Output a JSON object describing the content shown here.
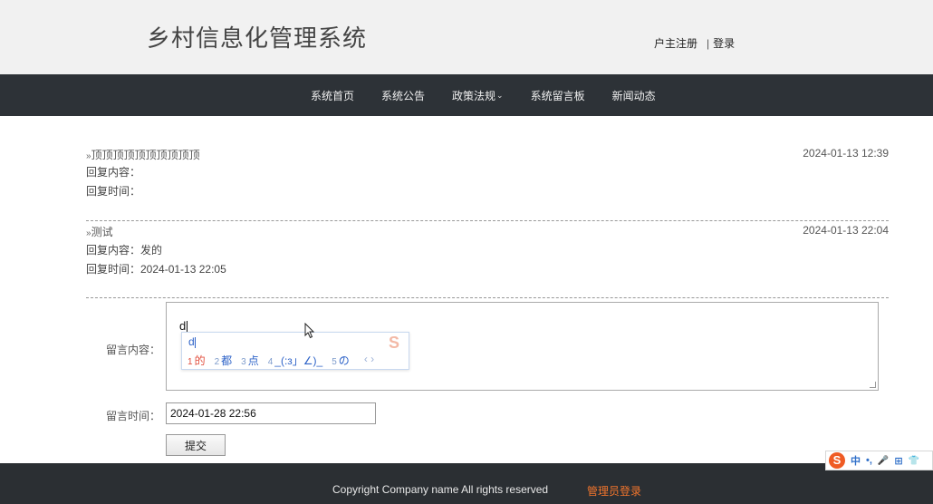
{
  "header": {
    "site_title": "乡村信息化管理系统",
    "register_link": "户主注册",
    "separator": "|",
    "login_link": "登录"
  },
  "nav": {
    "items": [
      {
        "label": "系统首页"
      },
      {
        "label": "系统公告"
      },
      {
        "label": "政策法规",
        "caret": "⌄"
      },
      {
        "label": "系统留言板"
      },
      {
        "label": "新闻动态"
      }
    ]
  },
  "messages": [
    {
      "prefix": "»",
      "title": "顶顶顶顶顶顶顶顶顶顶",
      "time": "2024-01-13 12:39",
      "reply_content": "回复内容：",
      "reply_time": "回复时间："
    },
    {
      "prefix": "»",
      "title": "测试",
      "time": "2024-01-13 22:04",
      "reply_content": "回复内容：发的",
      "reply_time": "回复时间：2024-01-13 22:05"
    }
  ],
  "form": {
    "content_label": "留言内容：",
    "content_value": "d",
    "time_label": "留言时间：",
    "time_value": "2024-01-28 22:56",
    "submit_label": "提交"
  },
  "ime": {
    "input": "d",
    "candidates": [
      {
        "num": "1",
        "text": "的"
      },
      {
        "num": "2",
        "text": "都"
      },
      {
        "num": "3",
        "text": "点"
      },
      {
        "num": "4",
        "text": "_(:з」∠)_"
      },
      {
        "num": "5",
        "text": "の"
      }
    ],
    "arrows": "‹ ›",
    "logo": "S",
    "toolbar_logo": "S",
    "toolbar_mode": "中",
    "toolbar_items": [
      "•,",
      "🎤",
      "⊞",
      "👕"
    ]
  },
  "footer": {
    "copyright": "Copyright Company name All rights reserved",
    "admin_link": "管理员登录"
  },
  "colors": {
    "navbar_bg": "#2d3237",
    "header_bg": "#f1f1f1",
    "admin_link": "#f2752c",
    "ime_accent": "#2e63c8",
    "ime_first": "#e24d3c"
  }
}
